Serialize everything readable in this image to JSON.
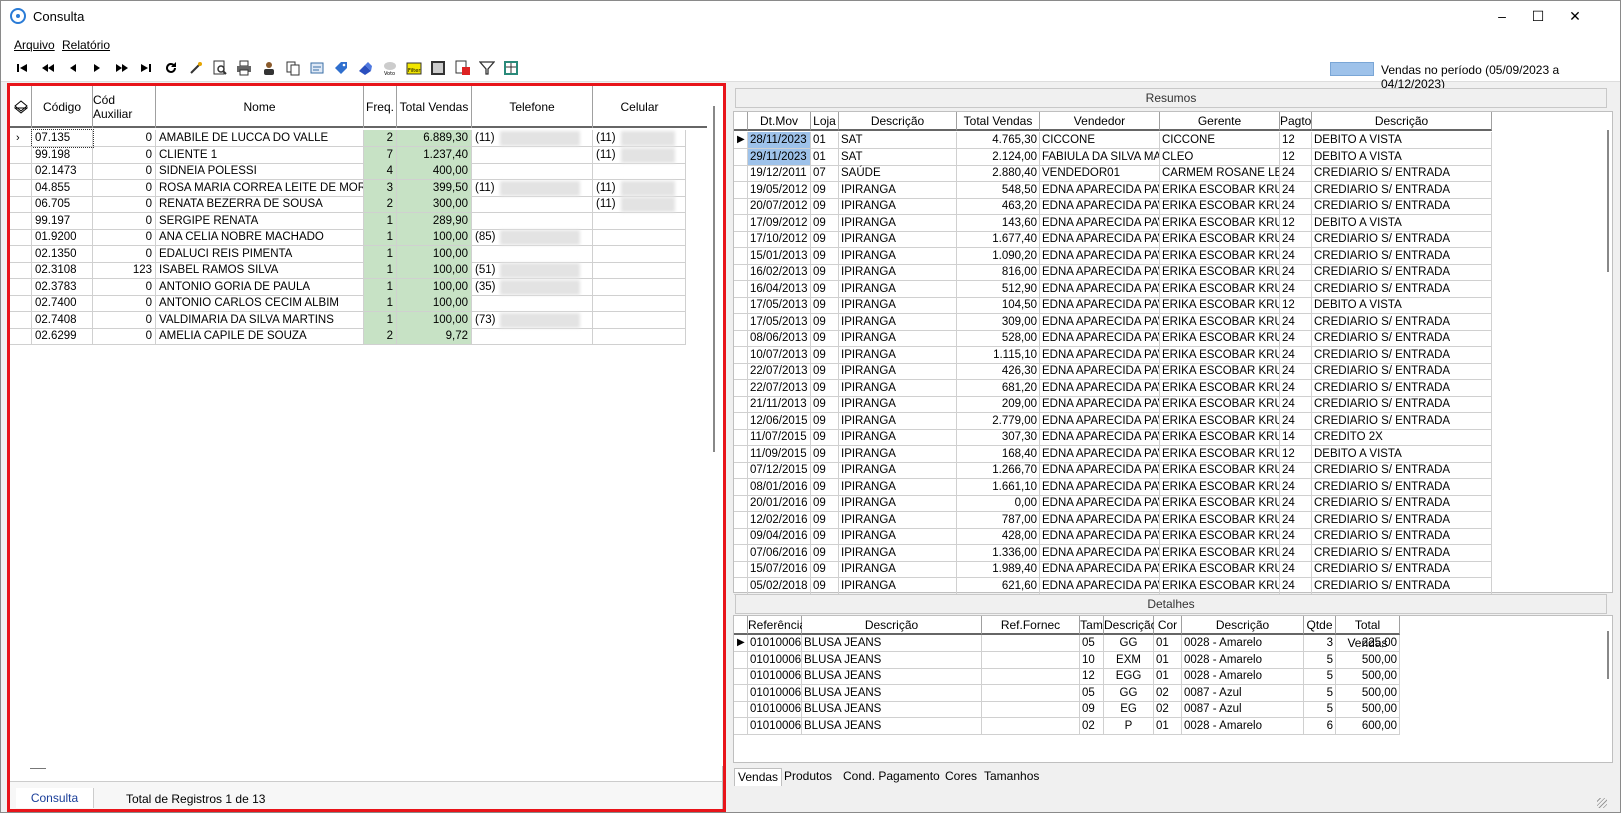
{
  "window": {
    "title": "Consulta",
    "minimize": "‒",
    "maximize": "☐",
    "close": "✕"
  },
  "menu": {
    "arquivo": "Arquivo",
    "relatorio": "Relatório"
  },
  "toolbar": {
    "legend_text": "Vendas no período (05/09/2023 a 04/12/2023)",
    "legend_color": "#9ec2ea",
    "buttons": [
      "first-icon",
      "prior-page-icon",
      "prior-icon",
      "next-icon",
      "next-page-icon",
      "last-icon",
      "refresh-icon",
      "magic-icon",
      "preview-icon",
      "print-icon",
      "user-icon",
      "copy-icon",
      "document-icon",
      "tag-icon",
      "eraser-icon",
      "vote-icon",
      "filter-color-icon",
      "image-icon",
      "export-icon",
      "funnel-icon",
      "table-icon"
    ]
  },
  "left": {
    "columns": [
      "Código",
      "Cód Auxiliar",
      "Nome",
      "Freq.",
      "Total Vendas",
      "Telefone",
      "Celular"
    ],
    "rows": [
      {
        "codigo": "07.135",
        "aux": "0",
        "nome": "AMABILE DE LUCCA DO VALLE",
        "freq": "2",
        "total": "6.889,30",
        "tel": "(11)",
        "cel": "(11)"
      },
      {
        "codigo": "99.198",
        "aux": "0",
        "nome": "CLIENTE 1",
        "freq": "7",
        "total": "1.237,40",
        "tel": "",
        "cel": "(11)"
      },
      {
        "codigo": "02.1473",
        "aux": "0",
        "nome": "SIDNEIA POLESSI",
        "freq": "4",
        "total": "400,00",
        "tel": "",
        "cel": ""
      },
      {
        "codigo": "04.855",
        "aux": "0",
        "nome": "ROSA MARIA CORREA LEITE DE MORAES",
        "freq": "3",
        "total": "399,50",
        "tel": "(11)",
        "cel": "(11)"
      },
      {
        "codigo": "06.705",
        "aux": "0",
        "nome": "RENATA  BEZERRA DE SOUSA",
        "freq": "2",
        "total": "300,00",
        "tel": "",
        "cel": "(11)"
      },
      {
        "codigo": "99.197",
        "aux": "0",
        "nome": "SERGIPE RENATA",
        "freq": "1",
        "total": "289,90",
        "tel": "",
        "cel": ""
      },
      {
        "codigo": "01.9200",
        "aux": "0",
        "nome": "ANA CELIA NOBRE MACHADO",
        "freq": "1",
        "total": "100,00",
        "tel": "(85)",
        "cel": ""
      },
      {
        "codigo": "02.1350",
        "aux": "0",
        "nome": "EDALUCI REIS PIMENTA",
        "freq": "1",
        "total": "100,00",
        "tel": "",
        "cel": ""
      },
      {
        "codigo": "02.3108",
        "aux": "123",
        "nome": "ISABEL RAMOS SILVA",
        "freq": "1",
        "total": "100,00",
        "tel": "(51)",
        "cel": ""
      },
      {
        "codigo": "02.3783",
        "aux": "0",
        "nome": "ANTONIO GORIA DE PAULA",
        "freq": "1",
        "total": "100,00",
        "tel": "(35)",
        "cel": ""
      },
      {
        "codigo": "02.7400",
        "aux": "0",
        "nome": "ANTONIO CARLOS CECIM ALBIM",
        "freq": "1",
        "total": "100,00",
        "tel": "",
        "cel": ""
      },
      {
        "codigo": "02.7408",
        "aux": "0",
        "nome": "VALDIMARIA DA SILVA MARTINS",
        "freq": "1",
        "total": "100,00",
        "tel": "(73)",
        "cel": ""
      },
      {
        "codigo": "02.6299",
        "aux": "0",
        "nome": "AMELIA CAPILE DE SOUZA",
        "freq": "2",
        "total": "9,72",
        "tel": "",
        "cel": ""
      }
    ],
    "status_tab": "Consulta",
    "status_total": "Total de Registros 1 de 13"
  },
  "resumos": {
    "title": "Resumos",
    "columns": [
      "Dt.Mov",
      "Loja",
      "Descrição",
      "Total Vendas",
      "Vendedor",
      "Gerente",
      "Pagto",
      "Descrição"
    ],
    "rows": [
      [
        "28/11/2023",
        "01",
        "SAT",
        "4.765,30",
        "CICCONE",
        "CICCONE",
        "12",
        "DEBITO A VISTA"
      ],
      [
        "29/11/2023",
        "01",
        "SAT",
        "2.124,00",
        "FABIULA DA SILVA MARTINS",
        "CLEO",
        "12",
        "DEBITO A VISTA"
      ],
      [
        "19/12/2011",
        "07",
        "SAÚDE",
        "2.880,40",
        "VENDEDOR01",
        "CARMEM ROSANE LEGUIÇA",
        "24",
        "CREDIARIO S/ ENTRADA"
      ],
      [
        "19/05/2012",
        "09",
        "IPIRANGA",
        "548,50",
        "EDNA APARECIDA PAVAN",
        "ERIKA ESCOBAR KRUPKA",
        "24",
        "CREDIARIO S/ ENTRADA"
      ],
      [
        "20/07/2012",
        "09",
        "IPIRANGA",
        "463,20",
        "EDNA APARECIDA PAVAN",
        "ERIKA ESCOBAR KRUPKA",
        "24",
        "CREDIARIO S/ ENTRADA"
      ],
      [
        "17/09/2012",
        "09",
        "IPIRANGA",
        "143,60",
        "EDNA APARECIDA PAVAN",
        "ERIKA ESCOBAR KRUPKA",
        "12",
        "DEBITO A VISTA"
      ],
      [
        "17/10/2012",
        "09",
        "IPIRANGA",
        "1.677,40",
        "EDNA APARECIDA PAVAN",
        "ERIKA ESCOBAR KRUPKA",
        "24",
        "CREDIARIO S/ ENTRADA"
      ],
      [
        "15/01/2013",
        "09",
        "IPIRANGA",
        "1.090,20",
        "EDNA APARECIDA PAVAN",
        "ERIKA ESCOBAR KRUPKA",
        "24",
        "CREDIARIO S/ ENTRADA"
      ],
      [
        "16/02/2013",
        "09",
        "IPIRANGA",
        "816,00",
        "EDNA APARECIDA PAVAN",
        "ERIKA ESCOBAR KRUPKA",
        "24",
        "CREDIARIO S/ ENTRADA"
      ],
      [
        "16/04/2013",
        "09",
        "IPIRANGA",
        "512,90",
        "EDNA APARECIDA PAVAN",
        "ERIKA ESCOBAR KRUPKA",
        "24",
        "CREDIARIO S/ ENTRADA"
      ],
      [
        "17/05/2013",
        "09",
        "IPIRANGA",
        "104,50",
        "EDNA APARECIDA PAVAN",
        "ERIKA ESCOBAR KRUPKA",
        "12",
        "DEBITO A VISTA"
      ],
      [
        "17/05/2013",
        "09",
        "IPIRANGA",
        "309,00",
        "EDNA APARECIDA PAVAN",
        "ERIKA ESCOBAR KRUPKA",
        "24",
        "CREDIARIO S/ ENTRADA"
      ],
      [
        "08/06/2013",
        "09",
        "IPIRANGA",
        "528,00",
        "EDNA APARECIDA PAVAN",
        "ERIKA ESCOBAR KRUPKA",
        "24",
        "CREDIARIO S/ ENTRADA"
      ],
      [
        "10/07/2013",
        "09",
        "IPIRANGA",
        "1.115,10",
        "EDNA APARECIDA PAVAN",
        "ERIKA ESCOBAR KRUPKA",
        "24",
        "CREDIARIO S/ ENTRADA"
      ],
      [
        "22/07/2013",
        "09",
        "IPIRANGA",
        "426,30",
        "EDNA APARECIDA PAVAN",
        "ERIKA ESCOBAR KRUPKA",
        "24",
        "CREDIARIO S/ ENTRADA"
      ],
      [
        "22/07/2013",
        "09",
        "IPIRANGA",
        "681,20",
        "EDNA APARECIDA PAVAN",
        "ERIKA ESCOBAR KRUPKA",
        "24",
        "CREDIARIO S/ ENTRADA"
      ],
      [
        "21/11/2013",
        "09",
        "IPIRANGA",
        "209,00",
        "EDNA APARECIDA PAVAN",
        "ERIKA ESCOBAR KRUPKA",
        "24",
        "CREDIARIO S/ ENTRADA"
      ],
      [
        "12/06/2015",
        "09",
        "IPIRANGA",
        "2.779,00",
        "EDNA APARECIDA PAVAN",
        "ERIKA ESCOBAR KRUPKA",
        "24",
        "CREDIARIO S/ ENTRADA"
      ],
      [
        "11/07/2015",
        "09",
        "IPIRANGA",
        "307,30",
        "EDNA APARECIDA PAVAN",
        "ERIKA ESCOBAR KRUPKA",
        "14",
        "CREDITO 2X"
      ],
      [
        "11/09/2015",
        "09",
        "IPIRANGA",
        "168,40",
        "EDNA APARECIDA PAVAN",
        "ERIKA ESCOBAR KRUPKA",
        "12",
        "DEBITO A VISTA"
      ],
      [
        "07/12/2015",
        "09",
        "IPIRANGA",
        "1.266,70",
        "EDNA APARECIDA PAVAN",
        "ERIKA ESCOBAR KRUPKA",
        "24",
        "CREDIARIO S/ ENTRADA"
      ],
      [
        "08/01/2016",
        "09",
        "IPIRANGA",
        "1.661,10",
        "EDNA APARECIDA PAVAN",
        "ERIKA ESCOBAR KRUPKA",
        "24",
        "CREDIARIO S/ ENTRADA"
      ],
      [
        "20/01/2016",
        "09",
        "IPIRANGA",
        "0,00",
        "EDNA APARECIDA PAVAN",
        "ERIKA ESCOBAR KRUPKA",
        "24",
        "CREDIARIO S/ ENTRADA"
      ],
      [
        "12/02/2016",
        "09",
        "IPIRANGA",
        "787,00",
        "EDNA APARECIDA PAVAN",
        "ERIKA ESCOBAR KRUPKA",
        "24",
        "CREDIARIO S/ ENTRADA"
      ],
      [
        "09/04/2016",
        "09",
        "IPIRANGA",
        "428,00",
        "EDNA APARECIDA PAVAN",
        "ERIKA ESCOBAR KRUPKA",
        "24",
        "CREDIARIO S/ ENTRADA"
      ],
      [
        "07/06/2016",
        "09",
        "IPIRANGA",
        "1.336,00",
        "EDNA APARECIDA PAVAN",
        "ERIKA ESCOBAR KRUPKA",
        "24",
        "CREDIARIO S/ ENTRADA"
      ],
      [
        "15/07/2016",
        "09",
        "IPIRANGA",
        "1.989,40",
        "EDNA APARECIDA PAVAN",
        "ERIKA ESCOBAR KRUPKA",
        "24",
        "CREDIARIO S/ ENTRADA"
      ],
      [
        "05/02/2018",
        "09",
        "IPIRANGA",
        "621,60",
        "EDNA APARECIDA PAVAN",
        "ERIKA ESCOBAR KRUPKA",
        "24",
        "CREDIARIO S/ ENTRADA"
      ]
    ]
  },
  "detalhes": {
    "title": "Detalhes",
    "columns": [
      "Referência",
      "Descrição",
      "Ref.Fornec",
      "Tam",
      "Descrição",
      "Cor",
      "Descrição",
      "Qtde",
      "Total Vendas"
    ],
    "rows": [
      [
        "01010006",
        "BLUSA JEANS",
        "",
        "05",
        "GG",
        "01",
        "0028 - Amarelo",
        "3",
        "225,00"
      ],
      [
        "01010006",
        "BLUSA JEANS",
        "",
        "10",
        "EXM",
        "01",
        "0028 - Amarelo",
        "5",
        "500,00"
      ],
      [
        "01010006",
        "BLUSA JEANS",
        "",
        "12",
        "EGG",
        "01",
        "0028 - Amarelo",
        "5",
        "500,00"
      ],
      [
        "01010006",
        "BLUSA JEANS",
        "",
        "05",
        "GG",
        "02",
        "0087 - Azul",
        "5",
        "500,00"
      ],
      [
        "01010006",
        "BLUSA JEANS",
        "",
        "09",
        "EG",
        "02",
        "0087 - Azul",
        "5",
        "500,00"
      ],
      [
        "01010006",
        "BLUSA JEANS",
        "",
        "02",
        "P",
        "01",
        "0028 - Amarelo",
        "6",
        "600,00"
      ]
    ]
  },
  "tabs": [
    "Vendas",
    "Produtos",
    "Cond. Pagamento",
    "Cores",
    "Tamanhos"
  ]
}
